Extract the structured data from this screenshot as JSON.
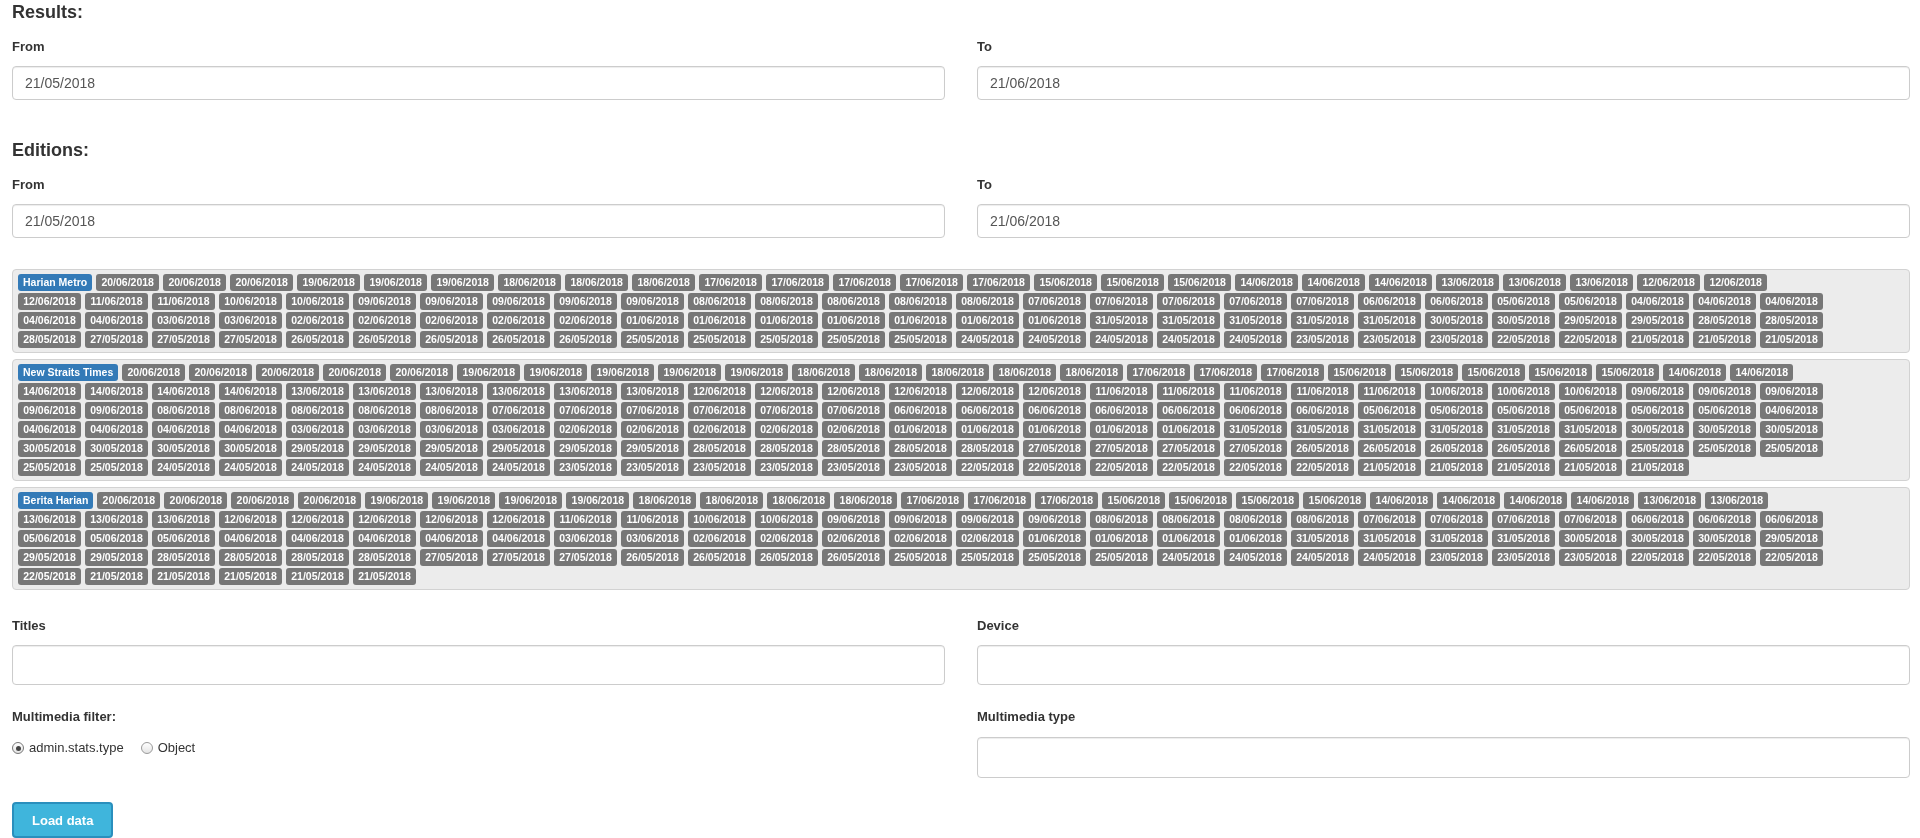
{
  "results": {
    "heading": "Results:",
    "from": {
      "label": "From",
      "value": "21/05/2018"
    },
    "to": {
      "label": "To",
      "value": "21/06/2018"
    }
  },
  "editions": {
    "heading": "Editions:",
    "from": {
      "label": "From",
      "value": "21/05/2018"
    },
    "to": {
      "label": "To",
      "value": "21/06/2018"
    },
    "groups": [
      {
        "label": "Harian Metro",
        "dates": [
          "20/06/2018",
          "20/06/2018",
          "20/06/2018",
          "19/06/2018",
          "19/06/2018",
          "19/06/2018",
          "18/06/2018",
          "18/06/2018",
          "18/06/2018",
          "17/06/2018",
          "17/06/2018",
          "17/06/2018",
          "17/06/2018",
          "17/06/2018",
          "15/06/2018",
          "15/06/2018",
          "15/06/2018",
          "14/06/2018",
          "14/06/2018",
          "14/06/2018",
          "13/06/2018",
          "13/06/2018",
          "13/06/2018",
          "12/06/2018",
          "12/06/2018",
          "12/06/2018",
          "11/06/2018",
          "11/06/2018",
          "10/06/2018",
          "10/06/2018",
          "09/06/2018",
          "09/06/2018",
          "09/06/2018",
          "09/06/2018",
          "09/06/2018",
          "08/06/2018",
          "08/06/2018",
          "08/06/2018",
          "08/06/2018",
          "08/06/2018",
          "07/06/2018",
          "07/06/2018",
          "07/06/2018",
          "07/06/2018",
          "07/06/2018",
          "06/06/2018",
          "06/06/2018",
          "05/06/2018",
          "05/06/2018",
          "04/06/2018",
          "04/06/2018",
          "04/06/2018",
          "04/06/2018",
          "04/06/2018",
          "03/06/2018",
          "03/06/2018",
          "02/06/2018",
          "02/06/2018",
          "02/06/2018",
          "02/06/2018",
          "02/06/2018",
          "01/06/2018",
          "01/06/2018",
          "01/06/2018",
          "01/06/2018",
          "01/06/2018",
          "01/06/2018",
          "01/06/2018",
          "31/05/2018",
          "31/05/2018",
          "31/05/2018",
          "31/05/2018",
          "31/05/2018",
          "30/05/2018",
          "30/05/2018",
          "29/05/2018",
          "29/05/2018",
          "28/05/2018",
          "28/05/2018",
          "28/05/2018",
          "27/05/2018",
          "27/05/2018",
          "27/05/2018",
          "26/05/2018",
          "26/05/2018",
          "26/05/2018",
          "26/05/2018",
          "26/05/2018",
          "25/05/2018",
          "25/05/2018",
          "25/05/2018",
          "25/05/2018",
          "25/05/2018",
          "24/05/2018",
          "24/05/2018",
          "24/05/2018",
          "24/05/2018",
          "24/05/2018",
          "23/05/2018",
          "23/05/2018",
          "23/05/2018",
          "22/05/2018",
          "22/05/2018",
          "21/05/2018",
          "21/05/2018",
          "21/05/2018"
        ]
      },
      {
        "label": "New Straits Times",
        "dates": [
          "20/06/2018",
          "20/06/2018",
          "20/06/2018",
          "20/06/2018",
          "20/06/2018",
          "19/06/2018",
          "19/06/2018",
          "19/06/2018",
          "19/06/2018",
          "19/06/2018",
          "18/06/2018",
          "18/06/2018",
          "18/06/2018",
          "18/06/2018",
          "18/06/2018",
          "17/06/2018",
          "17/06/2018",
          "17/06/2018",
          "15/06/2018",
          "15/06/2018",
          "15/06/2018",
          "15/06/2018",
          "15/06/2018",
          "14/06/2018",
          "14/06/2018",
          "14/06/2018",
          "14/06/2018",
          "14/06/2018",
          "14/06/2018",
          "13/06/2018",
          "13/06/2018",
          "13/06/2018",
          "13/06/2018",
          "13/06/2018",
          "13/06/2018",
          "12/06/2018",
          "12/06/2018",
          "12/06/2018",
          "12/06/2018",
          "12/06/2018",
          "12/06/2018",
          "11/06/2018",
          "11/06/2018",
          "11/06/2018",
          "11/06/2018",
          "11/06/2018",
          "10/06/2018",
          "10/06/2018",
          "10/06/2018",
          "09/06/2018",
          "09/06/2018",
          "09/06/2018",
          "09/06/2018",
          "09/06/2018",
          "08/06/2018",
          "08/06/2018",
          "08/06/2018",
          "08/06/2018",
          "08/06/2018",
          "07/06/2018",
          "07/06/2018",
          "07/06/2018",
          "07/06/2018",
          "07/06/2018",
          "07/06/2018",
          "06/06/2018",
          "06/06/2018",
          "06/06/2018",
          "06/06/2018",
          "06/06/2018",
          "06/06/2018",
          "06/06/2018",
          "05/06/2018",
          "05/06/2018",
          "05/06/2018",
          "05/06/2018",
          "05/06/2018",
          "05/06/2018",
          "04/06/2018",
          "04/06/2018",
          "04/06/2018",
          "04/06/2018",
          "04/06/2018",
          "03/06/2018",
          "03/06/2018",
          "03/06/2018",
          "03/06/2018",
          "02/06/2018",
          "02/06/2018",
          "02/06/2018",
          "02/06/2018",
          "02/06/2018",
          "01/06/2018",
          "01/06/2018",
          "01/06/2018",
          "01/06/2018",
          "01/06/2018",
          "31/05/2018",
          "31/05/2018",
          "31/05/2018",
          "31/05/2018",
          "31/05/2018",
          "31/05/2018",
          "30/05/2018",
          "30/05/2018",
          "30/05/2018",
          "30/05/2018",
          "30/05/2018",
          "30/05/2018",
          "30/05/2018",
          "29/05/2018",
          "29/05/2018",
          "29/05/2018",
          "29/05/2018",
          "29/05/2018",
          "29/05/2018",
          "28/05/2018",
          "28/05/2018",
          "28/05/2018",
          "28/05/2018",
          "28/05/2018",
          "27/05/2018",
          "27/05/2018",
          "27/05/2018",
          "27/05/2018",
          "26/05/2018",
          "26/05/2018",
          "26/05/2018",
          "26/05/2018",
          "26/05/2018",
          "25/05/2018",
          "25/05/2018",
          "25/05/2018",
          "25/05/2018",
          "25/05/2018",
          "24/05/2018",
          "24/05/2018",
          "24/05/2018",
          "24/05/2018",
          "24/05/2018",
          "24/05/2018",
          "23/05/2018",
          "23/05/2018",
          "23/05/2018",
          "23/05/2018",
          "23/05/2018",
          "23/05/2018",
          "22/05/2018",
          "22/05/2018",
          "22/05/2018",
          "22/05/2018",
          "22/05/2018",
          "22/05/2018",
          "21/05/2018",
          "21/05/2018",
          "21/05/2018",
          "21/05/2018",
          "21/05/2018"
        ]
      },
      {
        "label": "Berita Harian",
        "dates": [
          "20/06/2018",
          "20/06/2018",
          "20/06/2018",
          "20/06/2018",
          "19/06/2018",
          "19/06/2018",
          "19/06/2018",
          "19/06/2018",
          "18/06/2018",
          "18/06/2018",
          "18/06/2018",
          "18/06/2018",
          "17/06/2018",
          "17/06/2018",
          "17/06/2018",
          "15/06/2018",
          "15/06/2018",
          "15/06/2018",
          "15/06/2018",
          "14/06/2018",
          "14/06/2018",
          "14/06/2018",
          "14/06/2018",
          "13/06/2018",
          "13/06/2018",
          "13/06/2018",
          "13/06/2018",
          "13/06/2018",
          "12/06/2018",
          "12/06/2018",
          "12/06/2018",
          "12/06/2018",
          "12/06/2018",
          "11/06/2018",
          "11/06/2018",
          "10/06/2018",
          "10/06/2018",
          "09/06/2018",
          "09/06/2018",
          "09/06/2018",
          "09/06/2018",
          "08/06/2018",
          "08/06/2018",
          "08/06/2018",
          "08/06/2018",
          "07/06/2018",
          "07/06/2018",
          "07/06/2018",
          "07/06/2018",
          "06/06/2018",
          "06/06/2018",
          "06/06/2018",
          "05/06/2018",
          "05/06/2018",
          "05/06/2018",
          "04/06/2018",
          "04/06/2018",
          "04/06/2018",
          "04/06/2018",
          "04/06/2018",
          "03/06/2018",
          "03/06/2018",
          "02/06/2018",
          "02/06/2018",
          "02/06/2018",
          "02/06/2018",
          "02/06/2018",
          "01/06/2018",
          "01/06/2018",
          "01/06/2018",
          "01/06/2018",
          "31/05/2018",
          "31/05/2018",
          "31/05/2018",
          "31/05/2018",
          "30/05/2018",
          "30/05/2018",
          "30/05/2018",
          "29/05/2018",
          "29/05/2018",
          "29/05/2018",
          "28/05/2018",
          "28/05/2018",
          "28/05/2018",
          "28/05/2018",
          "27/05/2018",
          "27/05/2018",
          "27/05/2018",
          "26/05/2018",
          "26/05/2018",
          "26/05/2018",
          "26/05/2018",
          "25/05/2018",
          "25/05/2018",
          "25/05/2018",
          "25/05/2018",
          "24/05/2018",
          "24/05/2018",
          "24/05/2018",
          "24/05/2018",
          "23/05/2018",
          "23/05/2018",
          "23/05/2018",
          "22/05/2018",
          "22/05/2018",
          "22/05/2018",
          "22/05/2018",
          "21/05/2018",
          "21/05/2018",
          "21/05/2018",
          "21/05/2018",
          "21/05/2018"
        ]
      }
    ]
  },
  "filters": {
    "titles": {
      "label": "Titles"
    },
    "device": {
      "label": "Device"
    },
    "multimedia_filter": {
      "label": "Multimedia filter:",
      "options": [
        {
          "label": "admin.stats.type",
          "selected": true
        },
        {
          "label": "Object",
          "selected": false
        }
      ]
    },
    "multimedia_type": {
      "label": "Multimedia type"
    }
  },
  "load_button": {
    "label": "Load data"
  }
}
